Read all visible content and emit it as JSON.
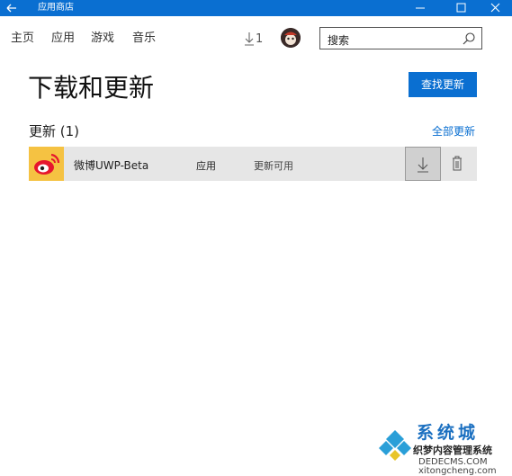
{
  "window": {
    "title": "应用商店",
    "title_color": "#0a6fd1"
  },
  "nav": {
    "items": [
      {
        "label": "主页"
      },
      {
        "label": "应用"
      },
      {
        "label": "游戏"
      },
      {
        "label": "音乐"
      }
    ],
    "downloads_count": "1",
    "search_placeholder": "搜索",
    "icons": {
      "download": "download-arrow-icon",
      "search": "magnifier-icon"
    }
  },
  "main": {
    "title": "下载和更新",
    "check_updates_label": "查找更新",
    "section_title": "更新 (1)",
    "update_all_label": "全部更新",
    "updates": [
      {
        "name": "微博UWP-Beta",
        "type": "应用",
        "status": "更新可用",
        "icon": "weibo-logo-icon"
      }
    ]
  },
  "watermark": {
    "brand": "系统城",
    "subtitle": "织梦内容管理系统",
    "url_line": "DEDECMS.COM",
    "url2": "xitongcheng.com"
  }
}
